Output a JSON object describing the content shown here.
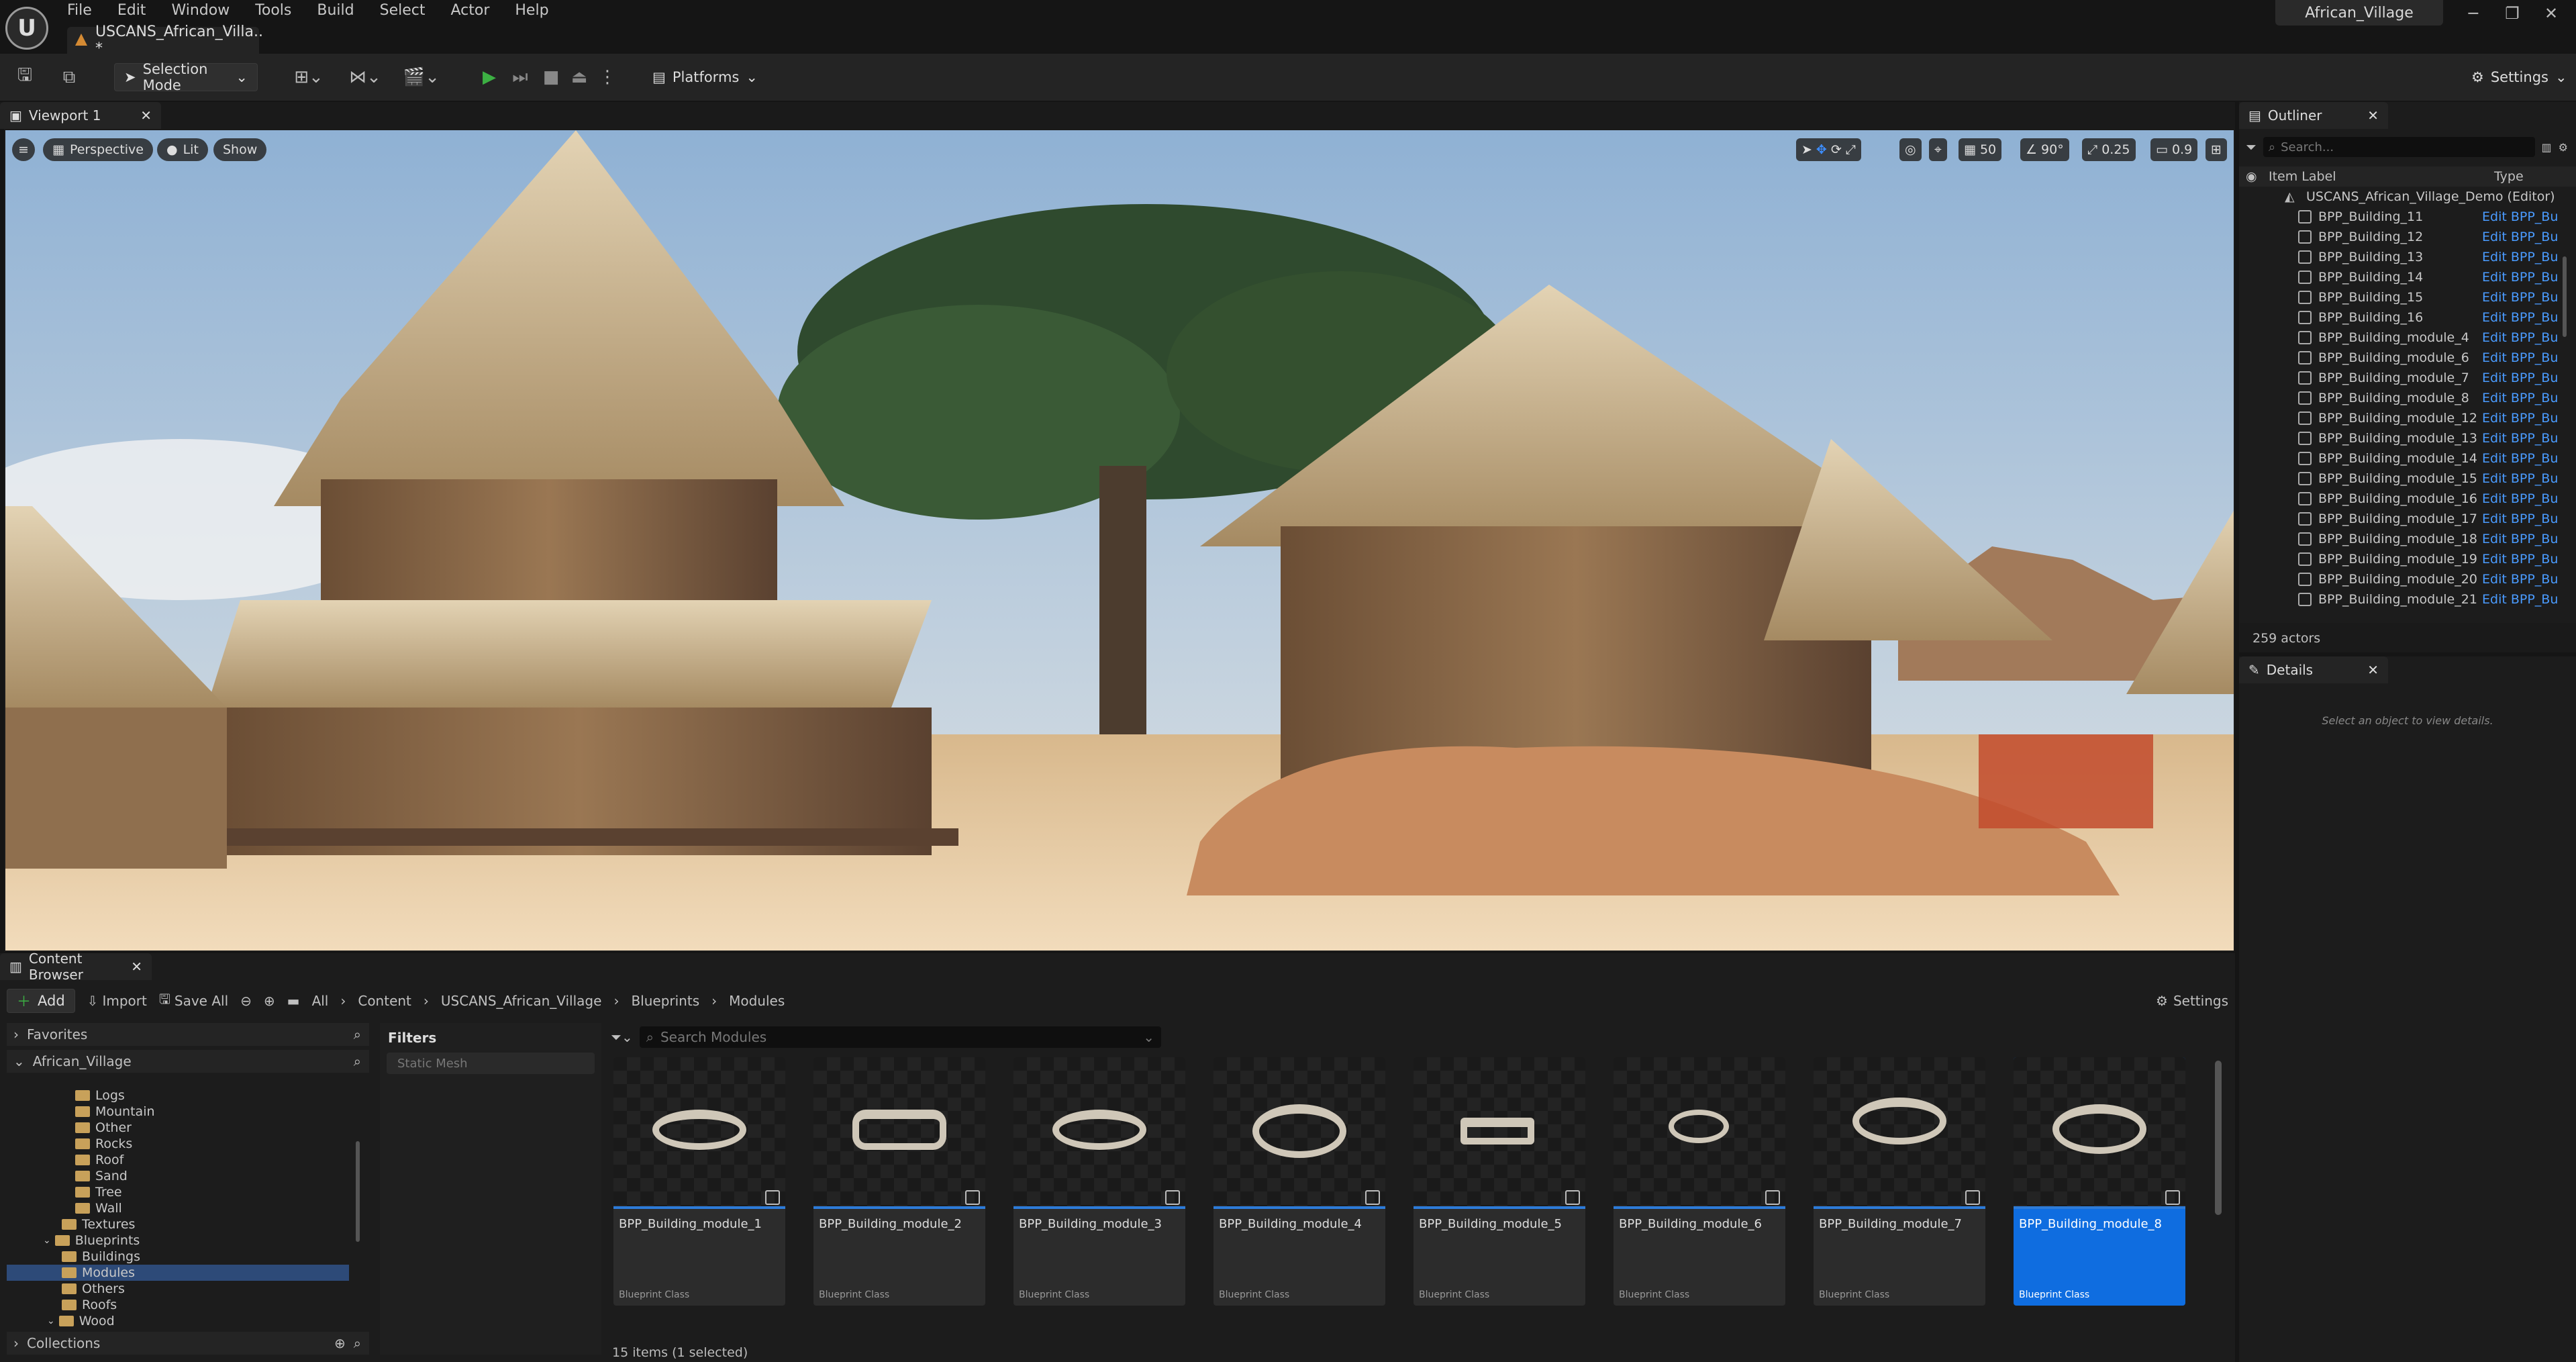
{
  "menu": {
    "items": [
      "File",
      "Edit",
      "Window",
      "Tools",
      "Build",
      "Select",
      "Actor",
      "Help"
    ]
  },
  "document_tab": {
    "label": "USCANS_African_Villa.. *"
  },
  "project_title": "African_Village",
  "toolbar": {
    "selection_mode": "Selection Mode",
    "platforms": "Platforms",
    "settings": "Settings"
  },
  "viewport": {
    "tab_label": "Viewport 1",
    "perspective": "Perspective",
    "lit": "Lit",
    "show": "Show",
    "grid_snap": "50",
    "rotation_snap": "90°",
    "scale_snap": "0.25",
    "camera_speed": "0.9"
  },
  "outliner": {
    "title": "Outliner",
    "search_placeholder": "Search...",
    "col_label": "Item Label",
    "col_type": "Type",
    "root": "USCANS_African_Village_Demo (Editor)",
    "rows": [
      {
        "name": "BPP_Building_11",
        "type": "Edit BPP_Bu"
      },
      {
        "name": "BPP_Building_12",
        "type": "Edit BPP_Bu"
      },
      {
        "name": "BPP_Building_13",
        "type": "Edit BPP_Bu"
      },
      {
        "name": "BPP_Building_14",
        "type": "Edit BPP_Bu"
      },
      {
        "name": "BPP_Building_15",
        "type": "Edit BPP_Bu"
      },
      {
        "name": "BPP_Building_16",
        "type": "Edit BPP_Bu"
      },
      {
        "name": "BPP_Building_module_4",
        "type": "Edit BPP_Bu"
      },
      {
        "name": "BPP_Building_module_6",
        "type": "Edit BPP_Bu"
      },
      {
        "name": "BPP_Building_module_7",
        "type": "Edit BPP_Bu"
      },
      {
        "name": "BPP_Building_module_8",
        "type": "Edit BPP_Bu"
      },
      {
        "name": "BPP_Building_module_12",
        "type": "Edit BPP_Bu"
      },
      {
        "name": "BPP_Building_module_13",
        "type": "Edit BPP_Bu"
      },
      {
        "name": "BPP_Building_module_14",
        "type": "Edit BPP_Bu"
      },
      {
        "name": "BPP_Building_module_15",
        "type": "Edit BPP_Bu"
      },
      {
        "name": "BPP_Building_module_16",
        "type": "Edit BPP_Bu"
      },
      {
        "name": "BPP_Building_module_17",
        "type": "Edit BPP_Bu"
      },
      {
        "name": "BPP_Building_module_18",
        "type": "Edit BPP_Bu"
      },
      {
        "name": "BPP_Building_module_19",
        "type": "Edit BPP_Bu"
      },
      {
        "name": "BPP_Building_module_20",
        "type": "Edit BPP_Bu"
      },
      {
        "name": "BPP_Building_module_21",
        "type": "Edit BPP_Bu"
      }
    ],
    "actor_count": "259 actors"
  },
  "details": {
    "title": "Details",
    "empty_hint": "Select an object to view details."
  },
  "content_browser": {
    "tab_label": "Content Browser",
    "add": "Add",
    "import": "Import",
    "save_all": "Save All",
    "settings": "Settings",
    "breadcrumb": [
      "All",
      "Content",
      "USCANS_African_Village",
      "Blueprints",
      "Modules"
    ],
    "favorites": "Favorites",
    "root_folder": "African_Village",
    "tree": [
      "Logs",
      "Mountain",
      "Other",
      "Rocks",
      "Roof",
      "Sand",
      "Tree",
      "Wall",
      "Textures",
      "Blueprints",
      "Buildings",
      "Modules",
      "Others",
      "Roofs",
      "Wood"
    ],
    "collections": "Collections",
    "filters_title": "Filters",
    "filter_chip": "Static Mesh",
    "search_placeholder": "Search Modules",
    "status": "15 items (1 selected)",
    "assets": [
      {
        "name": "BPP_Building_module_1",
        "class": "Blueprint Class"
      },
      {
        "name": "BPP_Building_module_2",
        "class": "Blueprint Class"
      },
      {
        "name": "BPP_Building_module_3",
        "class": "Blueprint Class"
      },
      {
        "name": "BPP_Building_module_4",
        "class": "Blueprint Class"
      },
      {
        "name": "BPP_Building_module_5",
        "class": "Blueprint Class"
      },
      {
        "name": "BPP_Building_module_6",
        "class": "Blueprint Class"
      },
      {
        "name": "BPP_Building_module_7",
        "class": "Blueprint Class"
      },
      {
        "name": "BPP_Building_module_8",
        "class": "Blueprint Class"
      }
    ]
  },
  "colors": {
    "accent_blue": "#0f6de0",
    "link_blue": "#4a9bff",
    "play_green": "#3cb043",
    "folder": "#c8a15a"
  }
}
